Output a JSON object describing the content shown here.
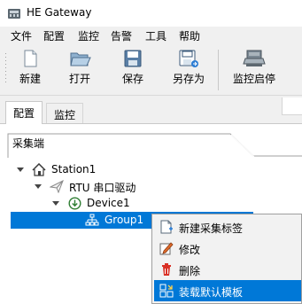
{
  "window": {
    "title": "HE Gateway",
    "icon": "gateway-app-icon"
  },
  "menu": [
    "文件",
    "配置",
    "监控",
    "告警",
    "工具",
    "帮助"
  ],
  "toolbar": {
    "new_label": "新建",
    "open_label": "打开",
    "save_label": "保存",
    "save_as_label": "另存为",
    "monitor_start_label": "监控启停"
  },
  "tabs": [
    {
      "label": "配置",
      "active": true
    },
    {
      "label": "监控",
      "active": false
    }
  ],
  "panel": {
    "group_label": "采集端"
  },
  "tree": {
    "station": "Station1",
    "driver": "RTU 串口驱动",
    "device": "Device1",
    "group": "Group1"
  },
  "context_menu": {
    "items": [
      {
        "label": "新建采集标签",
        "icon": "new-tag-icon"
      },
      {
        "label": "修改",
        "icon": "edit-icon"
      },
      {
        "label": "删除",
        "icon": "delete-icon"
      },
      {
        "label": "装载默认模板",
        "icon": "load-template-icon"
      }
    ],
    "highlighted_index": 3
  },
  "colors": {
    "selection": "#0078d7",
    "accent": "#2e7d32"
  }
}
